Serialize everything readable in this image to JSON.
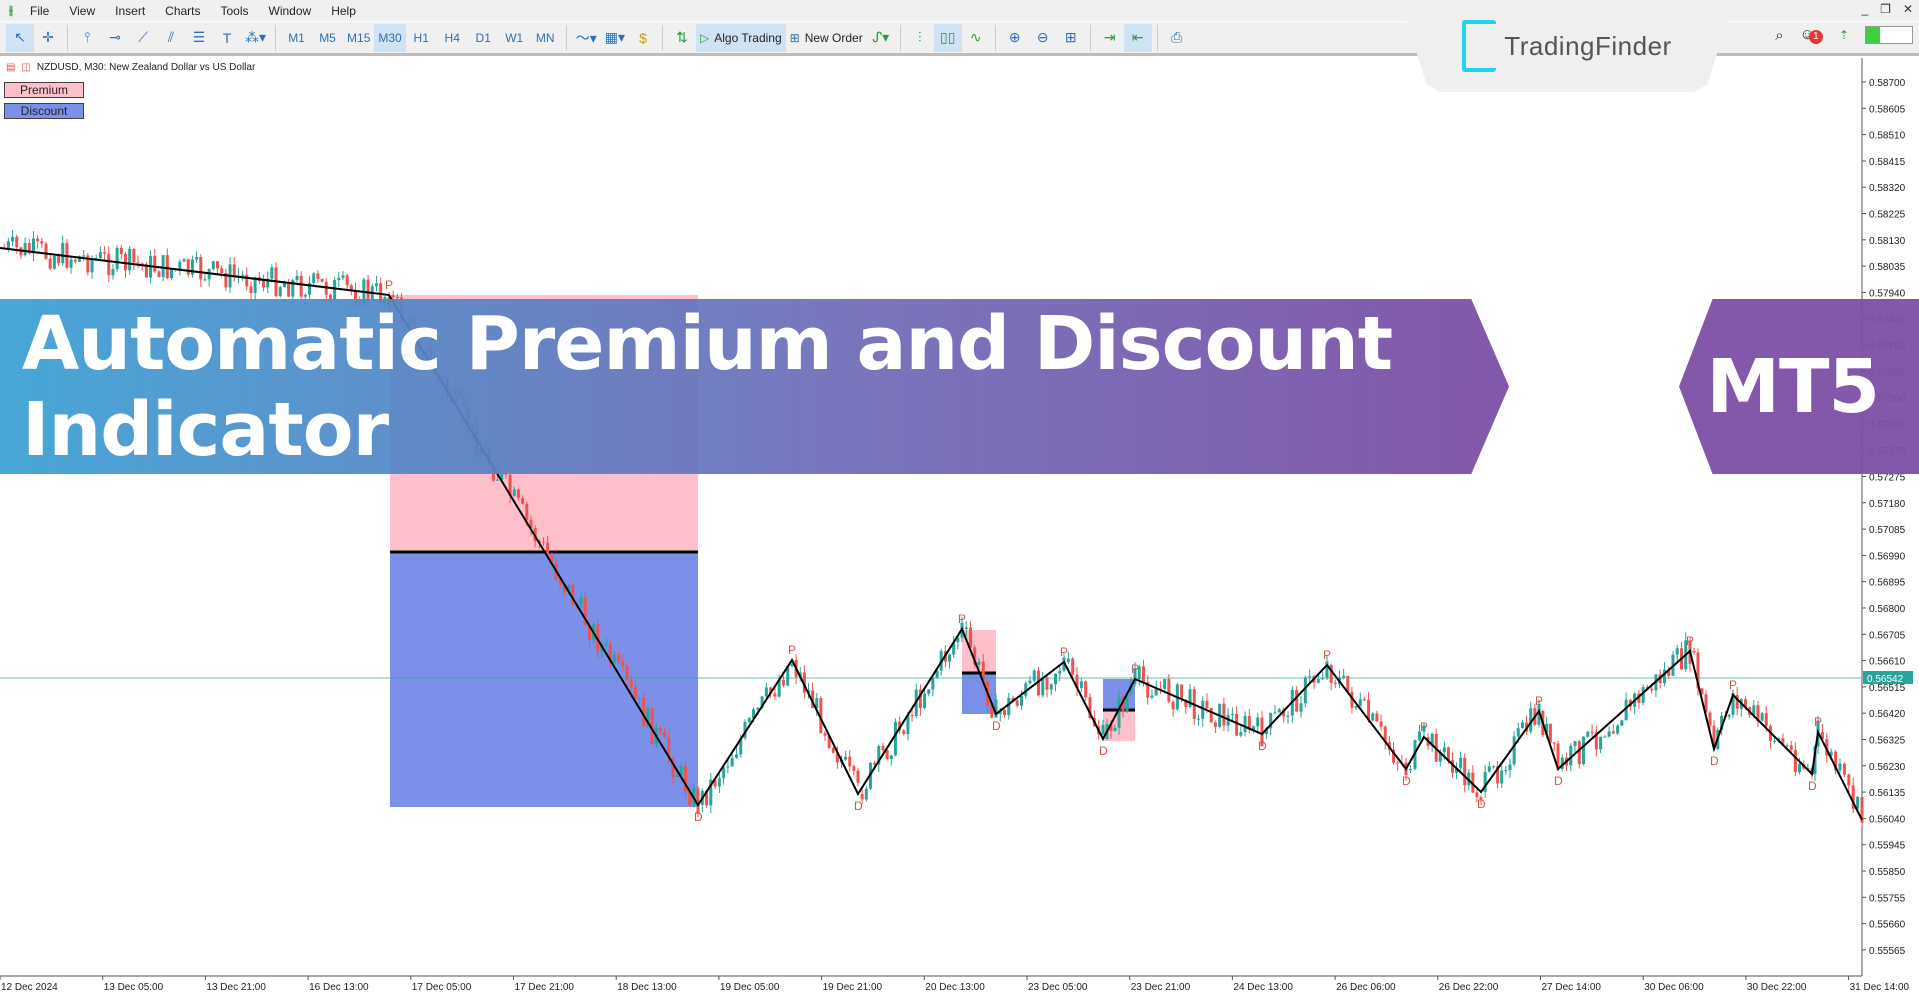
{
  "menu": {
    "items": [
      "File",
      "View",
      "Insert",
      "Charts",
      "Tools",
      "Window",
      "Help"
    ]
  },
  "toolbar": {
    "timeframes": [
      "M1",
      "M5",
      "M15",
      "M30",
      "H1",
      "H4",
      "D1",
      "W1",
      "MN"
    ],
    "active_timeframe": "M30",
    "algo_trading": "Algo Trading",
    "new_order": "New Order"
  },
  "logo": {
    "text": "TradingFinder"
  },
  "notifications": {
    "count": "1"
  },
  "chart": {
    "symbol_info": "NZDUSD, M30:  New Zealand Dollar vs US Dollar",
    "legend": {
      "premium": "Premium",
      "discount": "Discount"
    },
    "colors": {
      "premium": "#ffc0cb",
      "discount": "#7b90e8",
      "zigzag": "#000000",
      "label": "#d9534f",
      "current_price": "#26a69a",
      "bull": "#26a69a",
      "bear": "#ef5350"
    },
    "price_ticks": [
      "0.58700",
      "0.58605",
      "0.58510",
      "0.58415",
      "0.58320",
      "0.58225",
      "0.58130",
      "0.58035",
      "0.57940",
      "0.57845",
      "0.57750",
      "0.57655",
      "0.57560",
      "0.57465",
      "0.57370",
      "0.57275",
      "0.57180",
      "0.57085",
      "0.56990",
      "0.56895",
      "0.56800",
      "0.56705",
      "0.56610",
      "0.56515",
      "0.56420",
      "0.56325",
      "0.56230",
      "0.56135",
      "0.56040",
      "0.55945",
      "0.55850",
      "0.55755",
      "0.55660",
      "0.55565"
    ],
    "current_price": "0.56542",
    "time_ticks": [
      "12 Dec 2024",
      "13 Dec 05:00",
      "13 Dec 21:00",
      "16 Dec 13:00",
      "17 Dec 05:00",
      "17 Dec 21:00",
      "18 Dec 13:00",
      "19 Dec 05:00",
      "19 Dec 21:00",
      "20 Dec 13:00",
      "23 Dec 05:00",
      "23 Dec 21:00",
      "24 Dec 13:00",
      "26 Dec 06:00",
      "26 Dec 22:00",
      "27 Dec 14:00",
      "30 Dec 06:00",
      "30 Dec 22:00",
      "31 Dec 14:00"
    ],
    "pivot_labels": {
      "peak": "P",
      "dip": "D"
    }
  },
  "banner": {
    "title": "Automatic Premium and Discount Indicator",
    "platform": "MT5"
  }
}
